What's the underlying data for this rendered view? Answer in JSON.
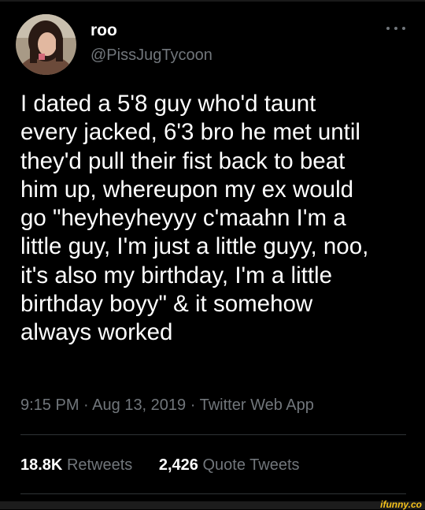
{
  "author": {
    "display_name": "roo",
    "handle": "@PissJugTycoon",
    "avatar_icon": "profile-photo"
  },
  "menu_icon": "more-dots-icon",
  "tweet": {
    "lines": [
      "I dated a 5'8 guy who'd taunt",
      "every jacked, 6'3 bro he met until",
      "they'd pull their fist back to beat",
      "him up, whereupon my ex would",
      "go \"heyheyheyyy c'maahn I'm a",
      "little guy, I'm just a little guyy, noo,",
      "it's also my birthday, I'm a little",
      "birthday boyy\" & it somehow",
      "always worked"
    ]
  },
  "meta": {
    "time": "9:15 PM",
    "separator": "·",
    "date": "Aug 13, 2019",
    "source": "Twitter Web App"
  },
  "stats": {
    "retweets_count": "18.8K",
    "retweets_label": "Retweets",
    "quotes_count": "2,426",
    "quotes_label": "Quote Tweets"
  },
  "watermark": "ifunny.co",
  "colors": {
    "background": "#000000",
    "text_primary": "#ffffff",
    "text_secondary": "#71767b",
    "divider": "#2f3336",
    "watermark": "#f4c11b"
  }
}
